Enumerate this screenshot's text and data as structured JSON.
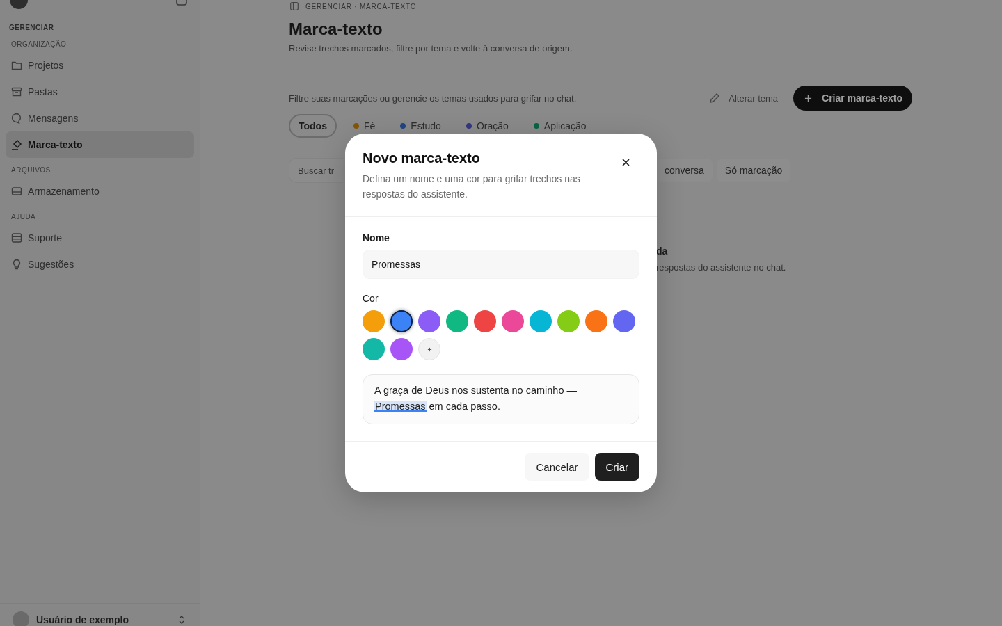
{
  "sidebar": {
    "heading": "GERENCIAR",
    "groups": [
      {
        "title": "ORGANIZAÇÃO",
        "items": [
          {
            "label": "Projetos",
            "selected": false
          },
          {
            "label": "Pastas",
            "selected": false
          },
          {
            "label": "Mensagens",
            "selected": false
          },
          {
            "label": "Marca-texto",
            "selected": true
          }
        ]
      },
      {
        "title": "ARQUIVOS",
        "items": [
          {
            "label": "Armazenamento",
            "selected": false
          }
        ]
      },
      {
        "title": "AJUDA",
        "items": [
          {
            "label": "Suporte",
            "selected": false
          },
          {
            "label": "Sugestões",
            "selected": false
          }
        ]
      }
    ],
    "user": {
      "name": "Usuário de exemplo"
    }
  },
  "main": {
    "breadcrumb": "GERENCIAR · MARCA-TEXTO",
    "title": "Marca-texto",
    "subtitle": "Revise trechos marcados, filtre por tema e volte à conversa de origem.",
    "toolbar": {
      "hint": "Filtre suas marcações ou gerencie os temas usados para grifar no chat.",
      "actions": [
        {
          "label": "Alterar tema",
          "kind": "link"
        },
        {
          "label": "Criar marca-texto",
          "kind": "primary"
        }
      ]
    },
    "filters": [
      {
        "label": "Todos",
        "selected": true
      },
      {
        "label": "Fé",
        "selected": false,
        "color": "#845506"
      },
      {
        "label": "Estudo",
        "selected": false,
        "color": "#204685"
      },
      {
        "label": "Oração",
        "selected": false,
        "color": "#353782"
      },
      {
        "label": "Aplicação",
        "selected": false,
        "color": "#096446"
      }
    ],
    "search": {
      "placeholder": "Buscar tr"
    },
    "view_options": [
      {
        "label": "conversa"
      },
      {
        "label": "Só marcação"
      }
    ],
    "empty_state": {
      "title": "da",
      "text": "respostas do assistente no chat."
    }
  },
  "dialog": {
    "title": "Novo marca-texto",
    "description": "Defina um nome e uma cor para grifar trechos nas respostas do assistente.",
    "name_field": {
      "label": "Nome",
      "value": "Promessas"
    },
    "color_field": {
      "label": "Cor",
      "swatches": [
        {
          "color": "#f59e0b",
          "selected": false
        },
        {
          "color": "#3b82f6",
          "selected": true
        },
        {
          "color": "#8b5cf6",
          "selected": false
        },
        {
          "color": "#10b981",
          "selected": false
        },
        {
          "color": "#ef4444",
          "selected": false
        },
        {
          "color": "#ec4899",
          "selected": false
        },
        {
          "color": "#06b6d4",
          "selected": false
        },
        {
          "color": "#84cc16",
          "selected": false
        },
        {
          "color": "#f97316",
          "selected": false
        },
        {
          "color": "#6366f1",
          "selected": false
        },
        {
          "color": "#14b8a6",
          "selected": false
        },
        {
          "color": "#a855f7",
          "selected": false
        }
      ]
    },
    "preview": {
      "before": "A graça de Deus nos sustenta no caminho —",
      "highlight": "Promessas",
      "after": "em cada passo."
    },
    "buttons": [
      {
        "label": "Cancelar",
        "kind": "secondary"
      },
      {
        "label": "Criar",
        "kind": "primary"
      }
    ]
  }
}
